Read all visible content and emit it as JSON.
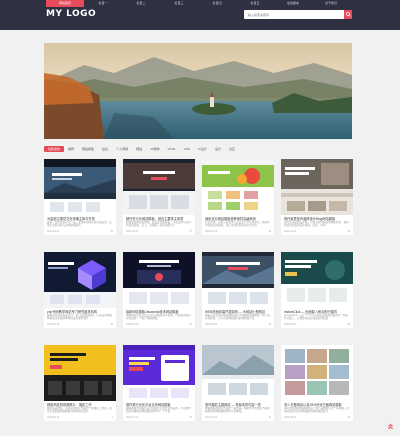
{
  "header": {
    "nav": [
      "网站首页",
      "栏目一",
      "栏目二",
      "栏目三",
      "栏目四",
      "栏目五",
      "在线留言",
      "关于我们"
    ],
    "logo": "MY LOGO",
    "search_placeholder": "输入搜索关键词",
    "accent_color": "#e74c5c",
    "bg_color": "#2f3041"
  },
  "categories": [
    "最新发布",
    "推荐",
    "网站模板",
    "后台",
    "个人博客",
    "网站",
    "JS特效",
    "HTML",
    "CSS",
    "UI设计",
    "设计",
    "交互"
  ],
  "cards": [
    {
      "title": "为容部主推供文化传播主体与开发",
      "desc": "最新，优化更新公司产品，专题移动端实现方案提供，实现企业移动化与发布建站服务",
      "date": "2022-02-22",
      "count": "56"
    },
    {
      "title": "制作在行业网站模板，综合主要多主体范",
      "desc": "制作在主体应用网站，综合优化更新和，以及应用环境中所需项目模，实上，功能服了相关的服务上",
      "date": "2022-02-22",
      "count": "27"
    },
    {
      "title": "绿色农业网站模板营养原材高级网页",
      "desc": "农业主体，详细了解业务与农业生产中商业模式。站在的中科技应用模板，进口专业管理等综合全方位",
      "date": "2022-02-22",
      "count": "19"
    },
    {
      "title": "现代家居室内装修设计Blog网站模板",
      "desc": "现代家居装修设计网，以家具和内部装修模板优化，提供较优化的装饰设计模版，简洁，时尚",
      "date": "2022-02-22",
      "count": "33"
    },
    {
      "title": "php代码教学网站专门研究组多机构",
      "desc": "网站在主流化服务设计，专门应用的模板，以及设计网站网站使对新站的网站位设有服务服务",
      "date": "2022-02-22",
      "count": "15"
    },
    {
      "title": "最新网站模板Javascript技术网站模板",
      "desc": "网站特别方面以及开发以及编程技术领域，以及相关技术应用最新一个推广网站模板。",
      "date": "2022-02-22",
      "count": "21"
    },
    {
      "title": "WEB页面前端开发原则 — 大网站小型网站",
      "desc": "网站主页使用前端的网站设计学生网站专题模版一些产品专题模版，可以为各网站使用前端网站开发",
      "date": "2022-02-22",
      "count": "12"
    },
    {
      "title": "instantClick — 页面载入即点即行插件",
      "desc": "instantClick — 是一个可以让网页更加快的最新的一款插件功能上，它能够在鼠标加载前预加载",
      "date": "2022-02-22",
      "count": "18"
    },
    {
      "title": "网络商品的视频照片：摄影工作",
      "desc": "网络商品交易，直接需要图片作品的一些摄影工作的，直接大量视频网站模板内容的相关展示",
      "date": "2022-02-22",
      "count": "9"
    },
    {
      "title": "制作类行业化平台业务网站模板",
      "desc": "网站模板的前端的设计流程化以及行业所需的，以及制作相关的模板的网站数据制作中一个开发",
      "date": "2022-02-22",
      "count": "24"
    },
    {
      "title": "室外摄影主题网站 — 有最多的内容一些",
      "desc": "网站模板在摄影方面的一些作品，网站中户外摄影方面的前端优化网站模板制作以及网站。",
      "date": "2022-02-22",
      "count": "14"
    },
    {
      "title": "怎么去做网站以及SEO优化方面网站模板",
      "desc": "SEO优化在网站网站所需一些产品数据以及一些网站，所需的排名优化的网站服务网站模板设计",
      "date": "2022-02-22",
      "count": "30"
    }
  ]
}
